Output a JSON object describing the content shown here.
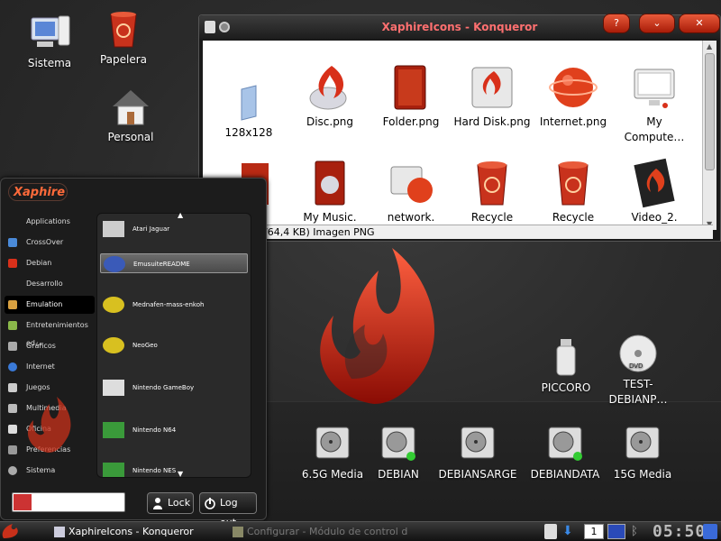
{
  "desktop": {
    "icons": [
      {
        "label": "Sistema",
        "icon": "computer-icon"
      },
      {
        "label": "Papelera",
        "icon": "trash-icon"
      },
      {
        "label": "Personal",
        "icon": "home-icon"
      },
      {
        "label": "PICCORO",
        "icon": "usb-drive-icon"
      },
      {
        "label": "TEST-DEBIANP…",
        "icon": "dvd-icon"
      },
      {
        "label": "6.5G Media",
        "icon": "hard-disk-icon"
      },
      {
        "label": "DEBIAN",
        "icon": "hard-disk-icon"
      },
      {
        "label": "DEBIANSARGE",
        "icon": "hard-disk-icon"
      },
      {
        "label": "DEBIANDATA",
        "icon": "hard-disk-icon"
      },
      {
        "label": "15G Media",
        "icon": "hard-disk-icon"
      }
    ]
  },
  "konqueror": {
    "title": "XaphireIcons - Konqueror",
    "files": [
      {
        "label": "128x128",
        "icon": "folder-blue-icon"
      },
      {
        "label": "Disc.png",
        "icon": "disc-icon"
      },
      {
        "label": "Folder.png",
        "icon": "folder-red-icon"
      },
      {
        "label": "Hard Disk.png",
        "icon": "hard-disk-icon"
      },
      {
        "label": "Internet.png",
        "icon": "internet-icon"
      },
      {
        "label": "My Compute…",
        "icon": "monitor-icon"
      },
      {
        "label": "",
        "icon": "red-doc-icon"
      },
      {
        "label": "My Music.",
        "icon": "music-icon"
      },
      {
        "label": "network.",
        "icon": "network-icon"
      },
      {
        "label": "Recycle",
        "icon": "recycle-icon"
      },
      {
        "label": "Recycle",
        "icon": "recycle-icon"
      },
      {
        "label": "Video_2.",
        "icon": "video-icon"
      }
    ],
    "status": "/64,4 KB)  Imagen PNG"
  },
  "menu": {
    "logo": "Xaphire",
    "categories": [
      {
        "label": "Applications"
      },
      {
        "label": "CrossOver"
      },
      {
        "label": "Debian"
      },
      {
        "label": "Desarrollo"
      },
      {
        "label": "Emulation"
      },
      {
        "label": "Entretenimientos ed…"
      },
      {
        "label": "Gráficos"
      },
      {
        "label": "Internet"
      },
      {
        "label": "Juegos"
      },
      {
        "label": "Multimedia"
      },
      {
        "label": "Oficina"
      },
      {
        "label": "Preferencias"
      },
      {
        "label": "Sistema"
      }
    ],
    "apps": [
      {
        "label": "Atari Jaguar"
      },
      {
        "label": "EmusuiteREADME"
      },
      {
        "label": "Mednafen-mass-enkoh"
      },
      {
        "label": "NeoGeo"
      },
      {
        "label": "Nintendo GameBoy"
      },
      {
        "label": "Nintendo N64"
      },
      {
        "label": "Nintendo NES"
      }
    ],
    "search_placeholder": "",
    "lock_label": "Lock",
    "logout_label": "Log out"
  },
  "taskbar": {
    "tasks": [
      {
        "label": "XaphireIcons - Konqueror"
      },
      {
        "label": "Configurar - Módulo de control de KD"
      }
    ],
    "desktop_number": "1",
    "clock": "05:50"
  },
  "colors": {
    "accent": "#d8341a",
    "title_text": "#ff7070"
  }
}
